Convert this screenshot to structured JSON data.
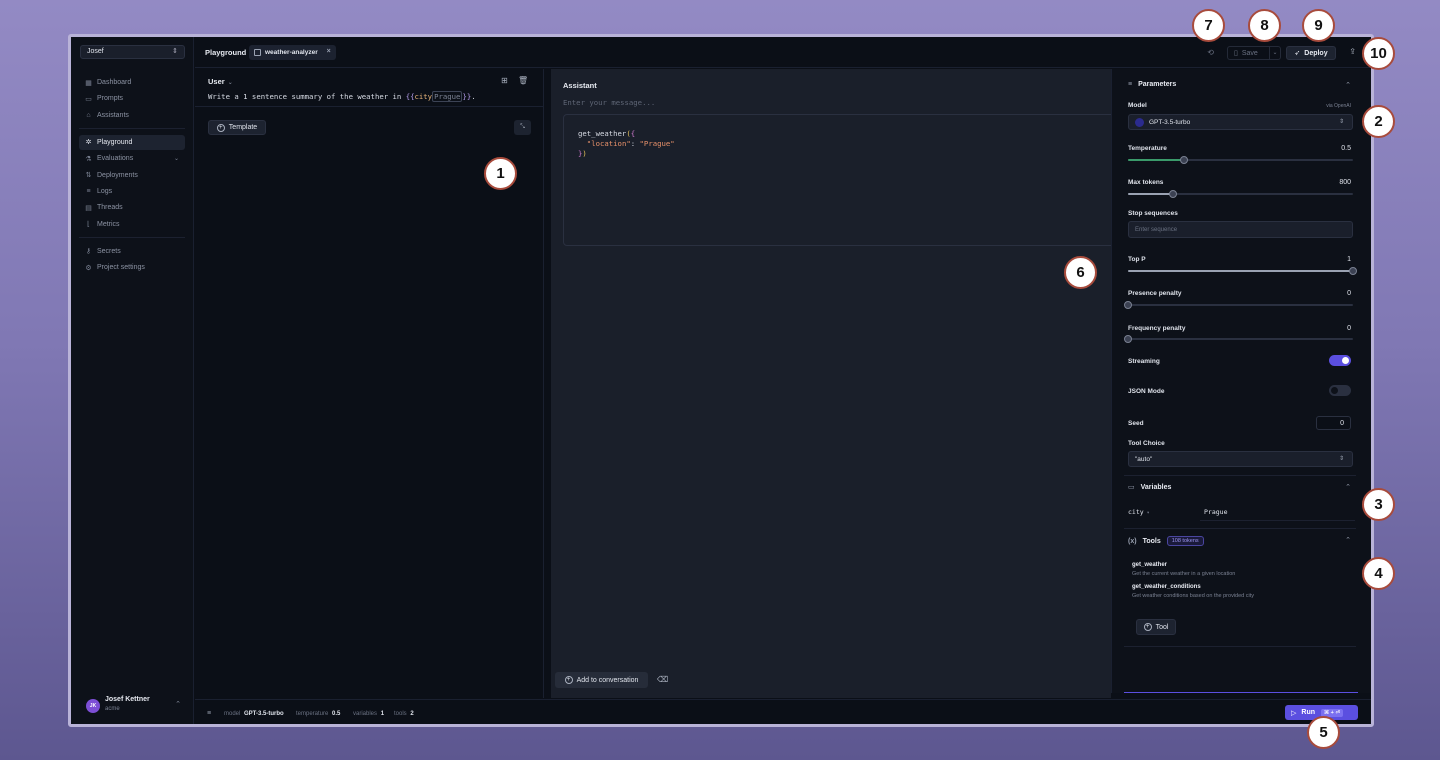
{
  "workspace": {
    "name": "Josef"
  },
  "sidebar": {
    "items": [
      {
        "label": "Dashboard",
        "icon": "dashboard-icon"
      },
      {
        "label": "Prompts",
        "icon": "prompts-icon"
      },
      {
        "label": "Assistants",
        "icon": "assistants-icon"
      },
      {
        "label": "Playground",
        "icon": "playground-icon",
        "active": true
      },
      {
        "label": "Evaluations",
        "icon": "flask-icon"
      },
      {
        "label": "Deployments",
        "icon": "deployments-icon"
      },
      {
        "label": "Logs",
        "icon": "database-icon"
      },
      {
        "label": "Threads",
        "icon": "threads-icon"
      },
      {
        "label": "Metrics",
        "icon": "chart-icon"
      },
      {
        "label": "Secrets",
        "icon": "key-icon"
      },
      {
        "label": "Project settings",
        "icon": "gear-icon"
      }
    ],
    "user": {
      "initials": "JK",
      "name": "Josef Kettner",
      "org": "acme"
    }
  },
  "topbar": {
    "breadcrumb": "Playground",
    "file_tab": "weather-analyzer",
    "save_label": "Save",
    "deploy_label": "Deploy"
  },
  "prompt": {
    "role": "User",
    "text_before": "Write a 1 sentence summary of the weather in ",
    "var_open": "{{",
    "var_name": "city",
    "var_value": "Prague",
    "var_close": "}}",
    "text_after": ".",
    "template_label": "Template"
  },
  "assistant": {
    "title": "Assistant",
    "placeholder": "Enter your message...",
    "code_fn": "get_weather",
    "code_key": "\"location\"",
    "code_val": "\"Prague\"",
    "add_label": "Add to conversation"
  },
  "params": {
    "title": "Parameters",
    "model_label": "Model",
    "model_via": "via OpenAI",
    "model_value": "GPT-3.5-turbo",
    "temperature_label": "Temperature",
    "temperature_value": "0.5",
    "temperature_fraction": 0.25,
    "max_tokens_label": "Max tokens",
    "max_tokens_value": "800",
    "max_tokens_fraction": 0.2,
    "stop_label": "Stop sequences",
    "stop_placeholder": "Enter sequence",
    "top_p_label": "Top P",
    "top_p_value": "1",
    "presence_label": "Presence penalty",
    "presence_value": "0",
    "frequency_label": "Frequency penalty",
    "frequency_value": "0",
    "streaming_label": "Streaming",
    "streaming_on": true,
    "json_label": "JSON Mode",
    "json_on": false,
    "seed_label": "Seed",
    "seed_value": "0",
    "tool_choice_label": "Tool Choice",
    "tool_choice_value": "\"auto\""
  },
  "variables": {
    "title": "Variables",
    "items": [
      {
        "key": "city",
        "value": "Prague"
      }
    ]
  },
  "tools": {
    "title": "Tools",
    "badge": "108 tokens",
    "items": [
      {
        "name": "get_weather",
        "desc": "Get the current weather in a given location"
      },
      {
        "name": "get_weather_conditions",
        "desc": "Get weather conditions based on the provided city"
      }
    ],
    "add_label": "Tool"
  },
  "bottombar": {
    "model_key": "model",
    "model_val": "GPT-3.5-turbo",
    "temp_key": "temperature",
    "temp_val": "0.5",
    "vars_key": "variables",
    "vars_val": "1",
    "tools_key": "tools",
    "tools_val": "2",
    "run_label": "Run",
    "run_shortcut": "⌘ + ⏎"
  },
  "callouts": [
    "1",
    "2",
    "3",
    "4",
    "5",
    "6",
    "7",
    "8",
    "9",
    "10"
  ],
  "colors": {
    "accent": "#5b4fe0",
    "callout_border": "#a84b3c",
    "slider_fill": "#3a9a6a"
  }
}
